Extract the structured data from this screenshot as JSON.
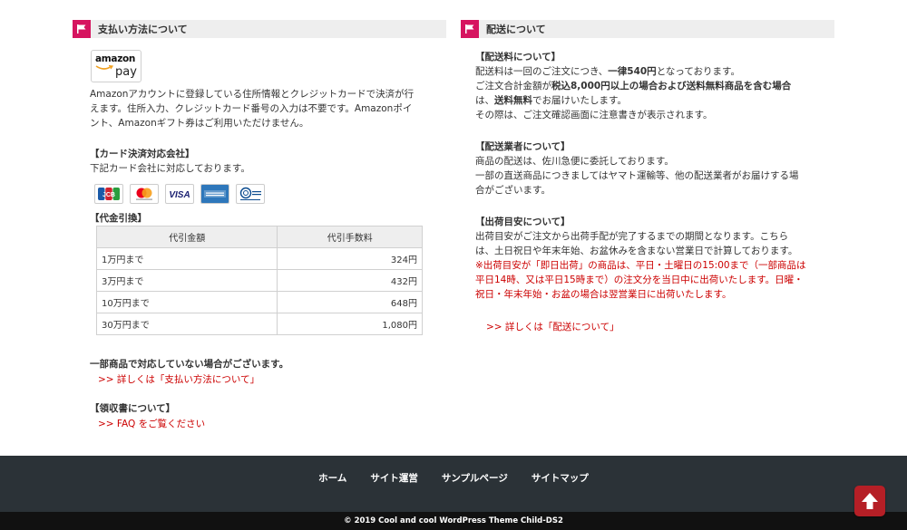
{
  "payment": {
    "title": "支払い方法について",
    "amazon_logo": {
      "word": "amazon",
      "pay": "pay"
    },
    "amazon_desc": [
      "Amazonアカウントに登録している住所情報とクレジットカードで決済が行",
      "えます。住所入力、クレジットカード番号の入力は不要です。Amazonポイ",
      "ント、Amazonギフト券はご利用いただけません。"
    ],
    "card_heading": "【カード決済対応会社】",
    "card_desc": "下記カード会社に対応しております。",
    "cards": [
      {
        "name": "JCB",
        "icon": "jcb-icon"
      },
      {
        "name": "mastercard",
        "icon": "mastercard-icon"
      },
      {
        "name": "VISA",
        "icon": "visa-icon"
      },
      {
        "name": "AMERICAN EXPRESS",
        "icon": "amex-icon"
      },
      {
        "name": "Diners Club",
        "icon": "diners-icon"
      }
    ],
    "cod_heading": "【代金引換】",
    "cod_table": {
      "headers": [
        "代引金額",
        "代引手数料"
      ],
      "rows": [
        [
          "1万円まで",
          "324円"
        ],
        [
          "3万円まで",
          "432円"
        ],
        [
          "10万円まで",
          "648円"
        ],
        [
          "30万円まで",
          "1,080円"
        ]
      ]
    },
    "notice": "一部商品で対応していない場合がございます。",
    "detail_link": ">> 詳しくは「支払い方法について」",
    "receipt_heading": "【領収書について】",
    "faq_link": ">> FAQ をご覧ください"
  },
  "delivery": {
    "title": "配送について",
    "fee_heading": "【配送料について】",
    "fee_l1_a": "配送料は一回のご注文につき、",
    "fee_l1_b": "一律540円",
    "fee_l1_c": "となっております。",
    "fee_l2_a": "ご注文合計金額が",
    "fee_l2_b": "税込8,000円以上の場合および送料無料商品を含む場合",
    "fee_l3_a": "は、",
    "fee_l3_b": "送料無料",
    "fee_l3_c": "でお届けいたします。",
    "fee_l4": "その際は、ご注文確認画面に注意書きが表示されます。",
    "carrier_heading": "【配送業者について】",
    "carrier_lines": [
      "商品の配送は、佐川急便に委託しております。",
      "一部の直送商品につきましてはヤマト運輸等、他の配送業者がお届けする場",
      "合がございます。"
    ],
    "ship_heading": "【出荷目安について】",
    "ship_lines": [
      "出荷目安がご注文から出荷手配が完了するまでの期間となります。こちら",
      "は、土日祝日や年末年始、お盆休みを含まない営業日で計算しております。"
    ],
    "ship_red_lines": [
      "※出荷目安が「即日出荷」の商品は、平日・土曜日の15:00まで（一部商品は",
      "平日14時、又は平日15時まで）の注文分を当日中に出荷いたします。日曜・",
      "祝日・年末年始・お盆の場合は翌営業日に出荷いたします。"
    ],
    "detail_link": ">> 詳しくは「配送について」"
  },
  "footer": {
    "nav": [
      "ホーム",
      "サイト運営",
      "サンプルページ",
      "サイトマップ"
    ],
    "copyright": "© 2019 Cool and cool WordPress Theme Child-DS2"
  },
  "colors": {
    "accent": "#d6145f",
    "link": "#cc0000",
    "footer_bg": "#2b3237"
  }
}
